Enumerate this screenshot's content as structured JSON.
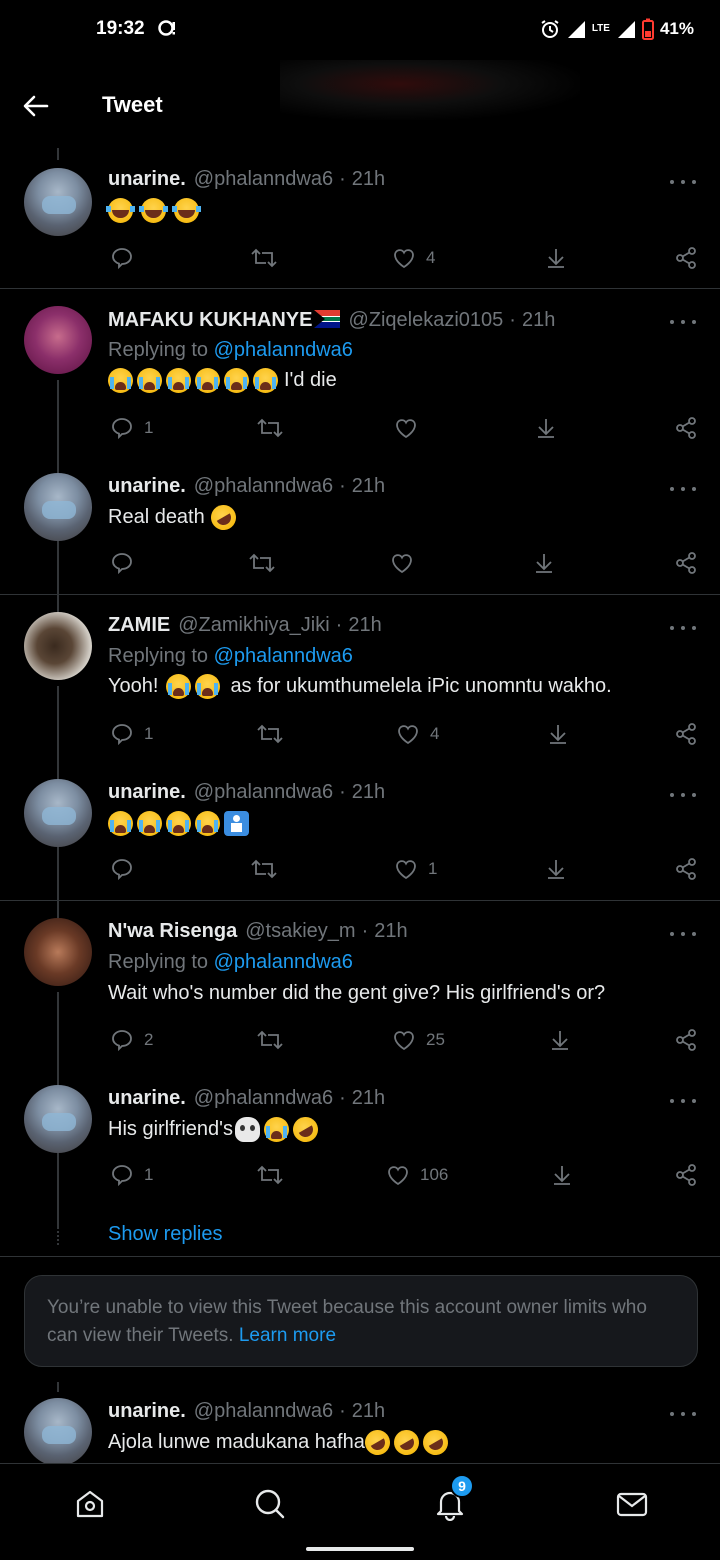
{
  "status_bar": {
    "time": "19:32",
    "network": "LTE",
    "battery": "41%"
  },
  "header": {
    "title": "Tweet"
  },
  "tweets": [
    {
      "name": "unarine.",
      "handle": "@phalanndwa6",
      "time": "21h",
      "text": "",
      "emojis": [
        "joy",
        "joy",
        "joy"
      ],
      "replies": "",
      "likes": "4"
    },
    {
      "name": "MAFAKU KUKHANYE",
      "handle": "@Ziqelekazi0105",
      "time": "21h",
      "replying_label": "Replying to",
      "replying_to": "@phalanndwa6",
      "text": "I'd die",
      "emojis": [
        "sob",
        "sob",
        "sob",
        "sob",
        "sob",
        "sob"
      ],
      "replies": "1",
      "likes": ""
    },
    {
      "name": "unarine.",
      "handle": "@phalanndwa6",
      "time": "21h",
      "text": "Real death",
      "emojis": [
        "rofl"
      ],
      "replies": "",
      "likes": ""
    },
    {
      "name": "ZAMIE",
      "handle": "@Zamikhiya_Jiki",
      "time": "21h",
      "replying_label": "Replying to",
      "replying_to": "@phalanndwa6",
      "text_before": "Yooh!",
      "text": "as for ukumthumelela iPic unomntu wakho.",
      "emojis": [
        "sob",
        "sob"
      ],
      "replies": "1",
      "likes": "4"
    },
    {
      "name": "unarine.",
      "handle": "@phalanndwa6",
      "time": "21h",
      "text": "",
      "emojis": [
        "sob",
        "sob",
        "sob",
        "sob",
        "person"
      ],
      "replies": "",
      "likes": "1"
    },
    {
      "name": "N'wa Risenga",
      "handle": "@tsakiey_m",
      "time": "21h",
      "replying_label": "Replying to",
      "replying_to": "@phalanndwa6",
      "text": "Wait who's number did the gent give? His girlfriend's or?",
      "emojis": [],
      "replies": "2",
      "likes": "25"
    },
    {
      "name": "unarine.",
      "handle": "@phalanndwa6",
      "time": "21h",
      "text": "His girlfriend's",
      "emojis": [
        "skull",
        "sob",
        "rofl"
      ],
      "replies": "1",
      "likes": "106"
    },
    {
      "name": "unarine.",
      "handle": "@phalanndwa6",
      "time": "21h",
      "text": "Ajola lunwe madukana hafha",
      "emojis": [
        "rofl",
        "rofl",
        "rofl"
      ]
    }
  ],
  "show_replies": "Show replies",
  "notice": {
    "text": "You’re unable to view this Tweet because this account owner limits who can view their Tweets.",
    "link": "Learn more"
  },
  "bottom_nav": {
    "notifications_badge": "9"
  },
  "icons": [
    "back-arrow-icon",
    "more-icon",
    "reply-icon",
    "retweet-icon",
    "like-icon",
    "download-icon",
    "share-icon",
    "home-icon",
    "search-icon",
    "bell-icon",
    "mail-icon"
  ]
}
